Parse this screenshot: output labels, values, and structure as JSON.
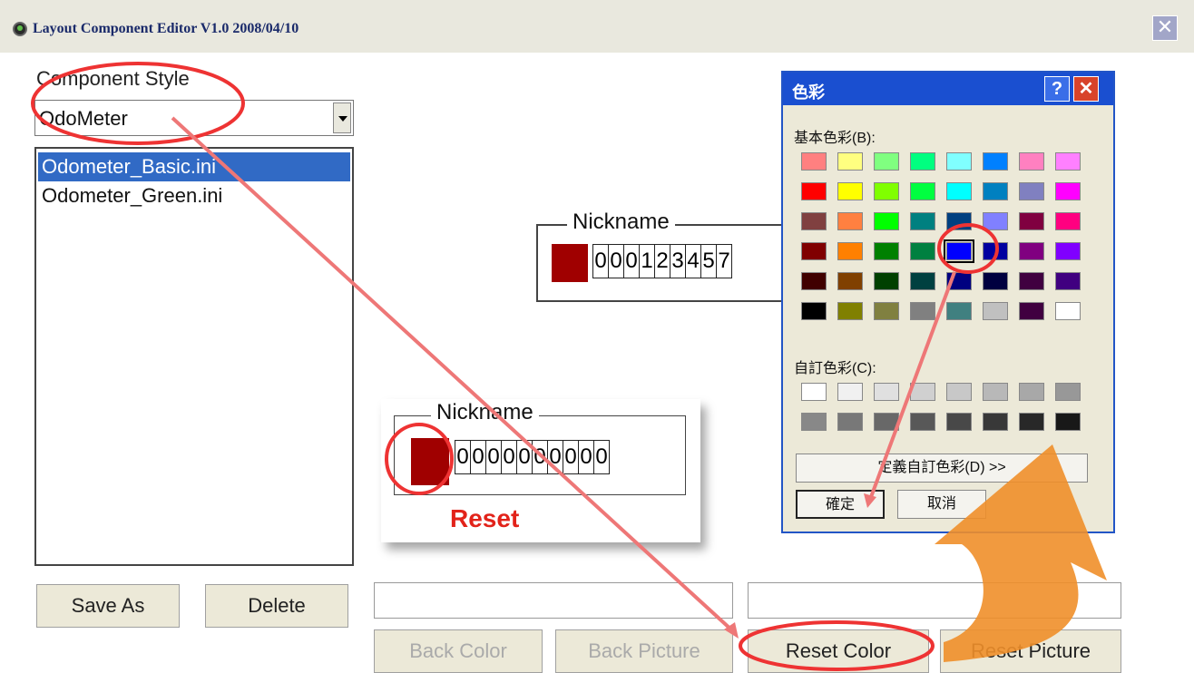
{
  "window": {
    "title": "Layout Component Editor V1.0  2008/04/10",
    "close_label": "✕"
  },
  "left_panel": {
    "style_label": "Component Style",
    "style_value": "OdoMeter",
    "files": [
      "Odometer_Basic.ini",
      "Odometer_Green.ini"
    ],
    "selected_index": 0,
    "save_as_label": "Save As",
    "delete_label": "Delete"
  },
  "preview_main": {
    "nickname": "Nickname",
    "digits": [
      "0",
      "0",
      "0",
      "1",
      "2",
      "3",
      "4",
      "5",
      "7"
    ],
    "swatch_color": "#a00000"
  },
  "preview_reset": {
    "nickname": "Nickname",
    "digits": [
      "0",
      "0",
      "0",
      "0",
      "0",
      "0",
      "0",
      "0",
      "0",
      "0"
    ],
    "swatch_color": "#a00000",
    "caption": "Reset"
  },
  "bottom": {
    "back_color_label": "Back Color",
    "back_picture_label": "Back Picture",
    "reset_color_label": "Reset Color",
    "reset_picture_label": "Reset Picture"
  },
  "color_dialog": {
    "title": "色彩",
    "help_label": "?",
    "close_label": "✕",
    "basic_label": "基本色彩(B):",
    "custom_label": "自訂色彩(C):",
    "define_label": "定義自訂色彩(D) >>",
    "ok_label": "確定",
    "cancel_label": "取消",
    "selected_color": "#0000ff",
    "basic_colors": [
      [
        "#ff8080",
        "#ffff80",
        "#80ff80",
        "#00ff80",
        "#80ffff",
        "#0080ff",
        "#ff80c0",
        "#ff80ff"
      ],
      [
        "#ff0000",
        "#ffff00",
        "#80ff00",
        "#00ff40",
        "#00ffff",
        "#0080c0",
        "#8080c0",
        "#ff00ff"
      ],
      [
        "#804040",
        "#ff8040",
        "#00ff00",
        "#008080",
        "#004080",
        "#8080ff",
        "#800040",
        "#ff0080"
      ],
      [
        "#800000",
        "#ff8000",
        "#008000",
        "#008040",
        "#0000ff",
        "#0000a0",
        "#800080",
        "#8000ff"
      ],
      [
        "#400000",
        "#804000",
        "#004000",
        "#004040",
        "#000080",
        "#000040",
        "#400040",
        "#400080"
      ],
      [
        "#000000",
        "#808000",
        "#808040",
        "#808080",
        "#408080",
        "#c0c0c0",
        "#400040",
        "#ffffff"
      ]
    ],
    "custom_colors": [
      [
        "#ffffff",
        "#f0f0f0",
        "#e0e0e0",
        "#d0d0d0",
        "#c8c8c8",
        "#b8b8b8",
        "#a8a8a8",
        "#989898"
      ],
      [
        "#888888",
        "#787878",
        "#686868",
        "#585858",
        "#484848",
        "#383838",
        "#282828",
        "#181818"
      ]
    ]
  }
}
